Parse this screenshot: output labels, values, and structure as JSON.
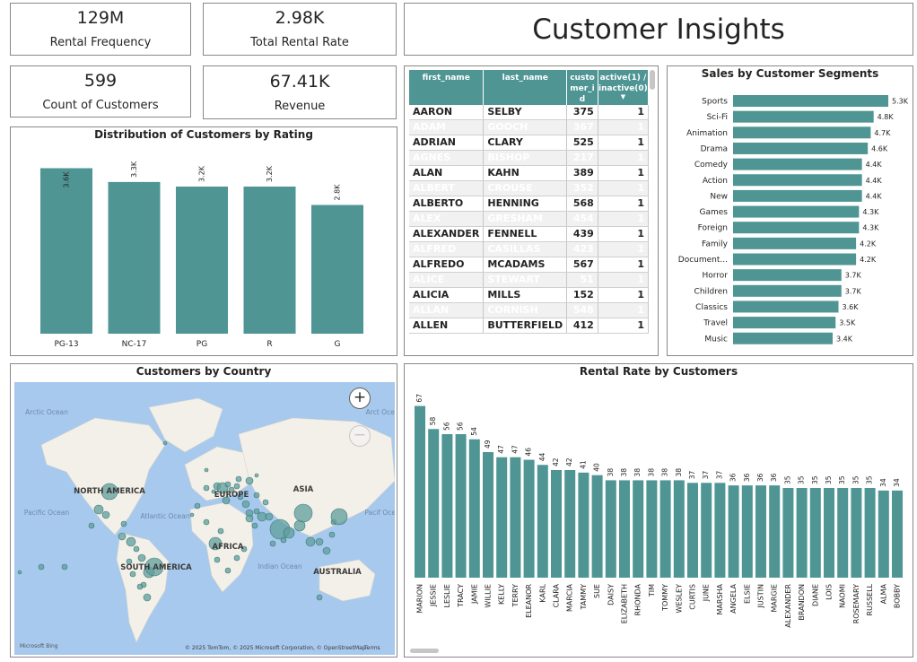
{
  "kpis": {
    "rental_frequency": {
      "value": "129M",
      "label": "Rental Frequency"
    },
    "total_rental_rate": {
      "value": "2.98K",
      "label": "Total Rental Rate"
    },
    "count_customers": {
      "value": "599",
      "label": "Count of Customers"
    },
    "revenue": {
      "value": "67.41K",
      "label": "Revenue"
    }
  },
  "page_title": "Customer Insights",
  "table": {
    "columns": [
      "first_name",
      "last_name",
      "customer_id",
      "active(1) / inactive(0)"
    ],
    "rows": [
      [
        "AARON",
        "SELBY",
        "375",
        "1"
      ],
      [
        "ADAM",
        "GOOCH",
        "367",
        "1"
      ],
      [
        "ADRIAN",
        "CLARY",
        "525",
        "1"
      ],
      [
        "AGNES",
        "BISHOP",
        "217",
        "1"
      ],
      [
        "ALAN",
        "KAHN",
        "389",
        "1"
      ],
      [
        "ALBERT",
        "CROUSE",
        "352",
        "1"
      ],
      [
        "ALBERTO",
        "HENNING",
        "568",
        "1"
      ],
      [
        "ALEX",
        "GRESHAM",
        "454",
        "1"
      ],
      [
        "ALEXANDER",
        "FENNELL",
        "439",
        "1"
      ],
      [
        "ALFRED",
        "CASILLAS",
        "423",
        "1"
      ],
      [
        "ALFREDO",
        "MCADAMS",
        "567",
        "1"
      ],
      [
        "ALICE",
        "STEWART",
        "51",
        "1"
      ],
      [
        "ALICIA",
        "MILLS",
        "152",
        "1"
      ],
      [
        "ALLAN",
        "CORNISH",
        "548",
        "1"
      ],
      [
        "ALLEN",
        "BUTTERFIELD",
        "412",
        "1"
      ]
    ]
  },
  "map": {
    "title": "Customers by Country",
    "labels": {
      "north_america": "NORTH AMERICA",
      "south_america": "SOUTH AMERICA",
      "europe": "EUROPE",
      "africa": "AFRICA",
      "asia": "ASIA",
      "australia": "AUSTRALIA",
      "arctic_left": "Arctic Ocean",
      "arctic_right": "Arct Ocea",
      "pacific_left": "Pacific Ocean",
      "pacific_right": "Pacif Ocea",
      "atlantic": "Atlantic Ocean",
      "indian": "Indian Ocean"
    },
    "attribution": "© 2025 TomTom, © 2025 Microsoft Corporation, © OpenStreetMap",
    "terms": "Terms",
    "logo": "Microsoft Bing",
    "zoom_in": "+",
    "zoom_out": "−"
  },
  "colors": {
    "bar": "#4e9594",
    "bar_dark": "#3f8a89",
    "map_water": "#a7c9ee",
    "map_land": "#f2f0e8",
    "bubble": "#5f9d9c"
  },
  "chart_data": [
    {
      "type": "bar",
      "title": "Distribution of Customers by Rating",
      "categories": [
        "PG-13",
        "NC-17",
        "PG",
        "R",
        "G"
      ],
      "values": [
        3.6,
        3.3,
        3.2,
        3.2,
        2.8
      ],
      "value_labels": [
        "3.6K",
        "3.3K",
        "3.2K",
        "3.2K",
        "2.8K"
      ],
      "ylim": [
        0,
        4
      ]
    },
    {
      "type": "bar",
      "orientation": "horizontal",
      "title": "Sales by Customer Segments",
      "categories": [
        "Sports",
        "Sci-Fi",
        "Animation",
        "Drama",
        "Comedy",
        "Action",
        "New",
        "Games",
        "Foreign",
        "Family",
        "Document...",
        "Horror",
        "Children",
        "Classics",
        "Travel",
        "Music"
      ],
      "values": [
        5.3,
        4.8,
        4.7,
        4.6,
        4.4,
        4.4,
        4.4,
        4.3,
        4.3,
        4.2,
        4.2,
        3.7,
        3.7,
        3.6,
        3.5,
        3.4
      ],
      "value_labels": [
        "5.3K",
        "4.8K",
        "4.7K",
        "4.6K",
        "4.4K",
        "4.4K",
        "4.4K",
        "4.3K",
        "4.3K",
        "4.2K",
        "4.2K",
        "3.7K",
        "3.7K",
        "3.6K",
        "3.5K",
        "3.4K"
      ],
      "xlim": [
        0,
        5.3
      ]
    },
    {
      "type": "bar",
      "title": "Rental Rate by Customers",
      "categories": [
        "MARION",
        "JESSIE",
        "LESLIE",
        "TRACY",
        "JAMIE",
        "WILLIE",
        "KELLY",
        "TERRY",
        "ELEANOR",
        "KARL",
        "CLARA",
        "MARCIA",
        "TAMMY",
        "SUE",
        "DAISY",
        "ELIZABETH",
        "RHONDA",
        "TIM",
        "TOMMY",
        "WESLEY",
        "CURTIS",
        "JUNE",
        "MARSHA",
        "ANGELA",
        "ELSIE",
        "JUSTIN",
        "MARGIE",
        "ALEXANDER",
        "BRANDON",
        "DIANE",
        "LOIS",
        "NAOMI",
        "ROSEMARY",
        "RUSSELL",
        "ALMA",
        "BOBBY"
      ],
      "values": [
        67,
        58,
        56,
        56,
        54,
        49,
        47,
        47,
        46,
        44,
        42,
        42,
        41,
        40,
        38,
        38,
        38,
        38,
        38,
        38,
        37,
        37,
        37,
        36,
        36,
        36,
        36,
        35,
        35,
        35,
        35,
        35,
        35,
        35,
        34,
        34
      ],
      "ylim": [
        0,
        70
      ]
    }
  ]
}
